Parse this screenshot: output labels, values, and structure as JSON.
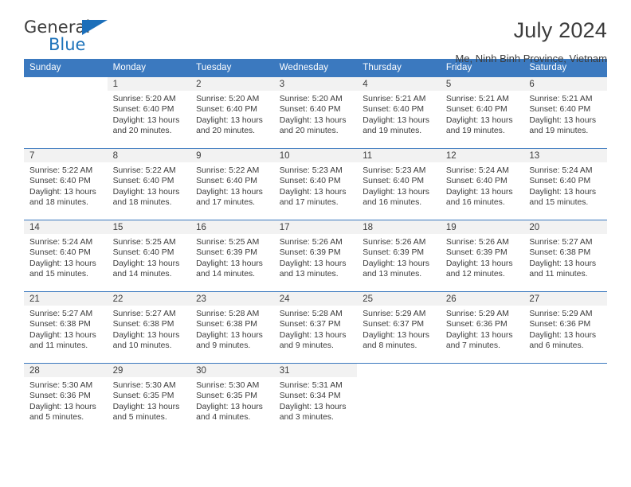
{
  "brand": {
    "name_top": "General",
    "name_bottom": "Blue",
    "accent_color": "#1c72ba"
  },
  "header": {
    "title": "July 2024",
    "subtitle": "Me, Ninh Binh Province, Vietnam"
  },
  "theme": {
    "header_blue": "#3b79bf",
    "day_band_gray": "#f2f2f2",
    "text_color": "#3c3c3c"
  },
  "calendar": {
    "weekday_headers": [
      "Sunday",
      "Monday",
      "Tuesday",
      "Wednesday",
      "Thursday",
      "Friday",
      "Saturday"
    ],
    "weeks": [
      [
        {
          "day": "",
          "lines": []
        },
        {
          "day": "1",
          "lines": [
            "Sunrise: 5:20 AM",
            "Sunset: 6:40 PM",
            "Daylight: 13 hours and 20 minutes."
          ]
        },
        {
          "day": "2",
          "lines": [
            "Sunrise: 5:20 AM",
            "Sunset: 6:40 PM",
            "Daylight: 13 hours and 20 minutes."
          ]
        },
        {
          "day": "3",
          "lines": [
            "Sunrise: 5:20 AM",
            "Sunset: 6:40 PM",
            "Daylight: 13 hours and 20 minutes."
          ]
        },
        {
          "day": "4",
          "lines": [
            "Sunrise: 5:21 AM",
            "Sunset: 6:40 PM",
            "Daylight: 13 hours and 19 minutes."
          ]
        },
        {
          "day": "5",
          "lines": [
            "Sunrise: 5:21 AM",
            "Sunset: 6:40 PM",
            "Daylight: 13 hours and 19 minutes."
          ]
        },
        {
          "day": "6",
          "lines": [
            "Sunrise: 5:21 AM",
            "Sunset: 6:40 PM",
            "Daylight: 13 hours and 19 minutes."
          ]
        }
      ],
      [
        {
          "day": "7",
          "lines": [
            "Sunrise: 5:22 AM",
            "Sunset: 6:40 PM",
            "Daylight: 13 hours and 18 minutes."
          ]
        },
        {
          "day": "8",
          "lines": [
            "Sunrise: 5:22 AM",
            "Sunset: 6:40 PM",
            "Daylight: 13 hours and 18 minutes."
          ]
        },
        {
          "day": "9",
          "lines": [
            "Sunrise: 5:22 AM",
            "Sunset: 6:40 PM",
            "Daylight: 13 hours and 17 minutes."
          ]
        },
        {
          "day": "10",
          "lines": [
            "Sunrise: 5:23 AM",
            "Sunset: 6:40 PM",
            "Daylight: 13 hours and 17 minutes."
          ]
        },
        {
          "day": "11",
          "lines": [
            "Sunrise: 5:23 AM",
            "Sunset: 6:40 PM",
            "Daylight: 13 hours and 16 minutes."
          ]
        },
        {
          "day": "12",
          "lines": [
            "Sunrise: 5:24 AM",
            "Sunset: 6:40 PM",
            "Daylight: 13 hours and 16 minutes."
          ]
        },
        {
          "day": "13",
          "lines": [
            "Sunrise: 5:24 AM",
            "Sunset: 6:40 PM",
            "Daylight: 13 hours and 15 minutes."
          ]
        }
      ],
      [
        {
          "day": "14",
          "lines": [
            "Sunrise: 5:24 AM",
            "Sunset: 6:40 PM",
            "Daylight: 13 hours and 15 minutes."
          ]
        },
        {
          "day": "15",
          "lines": [
            "Sunrise: 5:25 AM",
            "Sunset: 6:40 PM",
            "Daylight: 13 hours and 14 minutes."
          ]
        },
        {
          "day": "16",
          "lines": [
            "Sunrise: 5:25 AM",
            "Sunset: 6:39 PM",
            "Daylight: 13 hours and 14 minutes."
          ]
        },
        {
          "day": "17",
          "lines": [
            "Sunrise: 5:26 AM",
            "Sunset: 6:39 PM",
            "Daylight: 13 hours and 13 minutes."
          ]
        },
        {
          "day": "18",
          "lines": [
            "Sunrise: 5:26 AM",
            "Sunset: 6:39 PM",
            "Daylight: 13 hours and 13 minutes."
          ]
        },
        {
          "day": "19",
          "lines": [
            "Sunrise: 5:26 AM",
            "Sunset: 6:39 PM",
            "Daylight: 13 hours and 12 minutes."
          ]
        },
        {
          "day": "20",
          "lines": [
            "Sunrise: 5:27 AM",
            "Sunset: 6:38 PM",
            "Daylight: 13 hours and 11 minutes."
          ]
        }
      ],
      [
        {
          "day": "21",
          "lines": [
            "Sunrise: 5:27 AM",
            "Sunset: 6:38 PM",
            "Daylight: 13 hours and 11 minutes."
          ]
        },
        {
          "day": "22",
          "lines": [
            "Sunrise: 5:27 AM",
            "Sunset: 6:38 PM",
            "Daylight: 13 hours and 10 minutes."
          ]
        },
        {
          "day": "23",
          "lines": [
            "Sunrise: 5:28 AM",
            "Sunset: 6:38 PM",
            "Daylight: 13 hours and 9 minutes."
          ]
        },
        {
          "day": "24",
          "lines": [
            "Sunrise: 5:28 AM",
            "Sunset: 6:37 PM",
            "Daylight: 13 hours and 9 minutes."
          ]
        },
        {
          "day": "25",
          "lines": [
            "Sunrise: 5:29 AM",
            "Sunset: 6:37 PM",
            "Daylight: 13 hours and 8 minutes."
          ]
        },
        {
          "day": "26",
          "lines": [
            "Sunrise: 5:29 AM",
            "Sunset: 6:36 PM",
            "Daylight: 13 hours and 7 minutes."
          ]
        },
        {
          "day": "27",
          "lines": [
            "Sunrise: 5:29 AM",
            "Sunset: 6:36 PM",
            "Daylight: 13 hours and 6 minutes."
          ]
        }
      ],
      [
        {
          "day": "28",
          "lines": [
            "Sunrise: 5:30 AM",
            "Sunset: 6:36 PM",
            "Daylight: 13 hours and 5 minutes."
          ]
        },
        {
          "day": "29",
          "lines": [
            "Sunrise: 5:30 AM",
            "Sunset: 6:35 PM",
            "Daylight: 13 hours and 5 minutes."
          ]
        },
        {
          "day": "30",
          "lines": [
            "Sunrise: 5:30 AM",
            "Sunset: 6:35 PM",
            "Daylight: 13 hours and 4 minutes."
          ]
        },
        {
          "day": "31",
          "lines": [
            "Sunrise: 5:31 AM",
            "Sunset: 6:34 PM",
            "Daylight: 13 hours and 3 minutes."
          ]
        },
        {
          "day": "",
          "lines": []
        },
        {
          "day": "",
          "lines": []
        },
        {
          "day": "",
          "lines": []
        }
      ]
    ]
  }
}
